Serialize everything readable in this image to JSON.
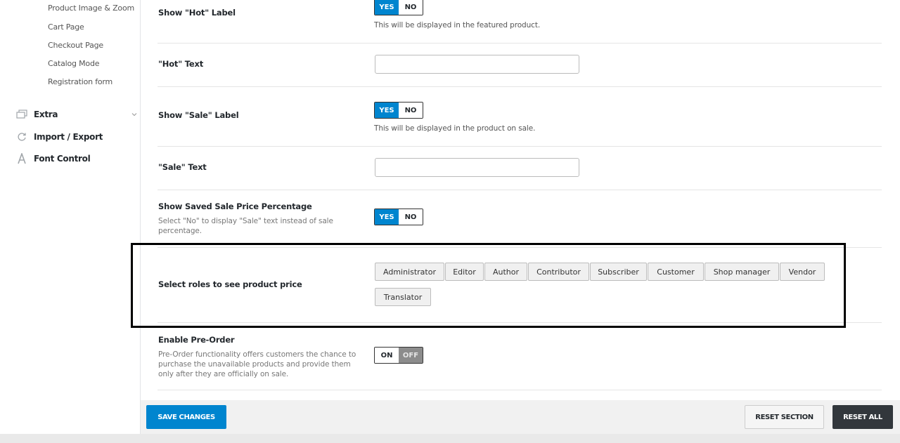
{
  "sidebar": {
    "sub_items": [
      "Product Image & Zoom",
      "Cart Page",
      "Checkout Page",
      "Catalog Mode",
      "Registration form"
    ],
    "sections": [
      {
        "label": "Extra",
        "icon": "stack-icon"
      },
      {
        "label": "Import / Export",
        "icon": "refresh-icon"
      },
      {
        "label": "Font Control",
        "icon": "font-icon"
      }
    ]
  },
  "settings": {
    "hot_label": {
      "title": "Show \"Hot\" Label",
      "yes": "YES",
      "no": "NO",
      "value": "YES",
      "hint": "This will be displayed in the featured product."
    },
    "hot_text": {
      "title": "\"Hot\" Text",
      "value": ""
    },
    "sale_label": {
      "title": "Show \"Sale\" Label",
      "yes": "YES",
      "no": "NO",
      "value": "YES",
      "hint": "This will be displayed in the product on sale."
    },
    "sale_text": {
      "title": "\"Sale\" Text",
      "value": ""
    },
    "saved_pct": {
      "title": "Show Saved Sale Price Percentage",
      "desc": "Select \"No\" to display \"Sale\" text instead of sale percentage.",
      "yes": "YES",
      "no": "NO",
      "value": "YES"
    },
    "roles": {
      "title": "Select roles to see product price",
      "options": [
        "Administrator",
        "Editor",
        "Author",
        "Contributor",
        "Subscriber",
        "Customer",
        "Shop manager",
        "Vendor",
        "Translator"
      ]
    },
    "pre_order": {
      "title": "Enable Pre-Order",
      "desc": "Pre-Order functionality offers customers the chance to purchase the unavailable products and provide them only after they are officially on sale.",
      "on": "ON",
      "off": "OFF",
      "value": "ON"
    }
  },
  "footer": {
    "save": "SAVE CHANGES",
    "reset_section": "RESET SECTION",
    "reset_all": "RESET ALL"
  },
  "colors": {
    "accent": "#0085cf",
    "dark_button": "#32373c"
  }
}
